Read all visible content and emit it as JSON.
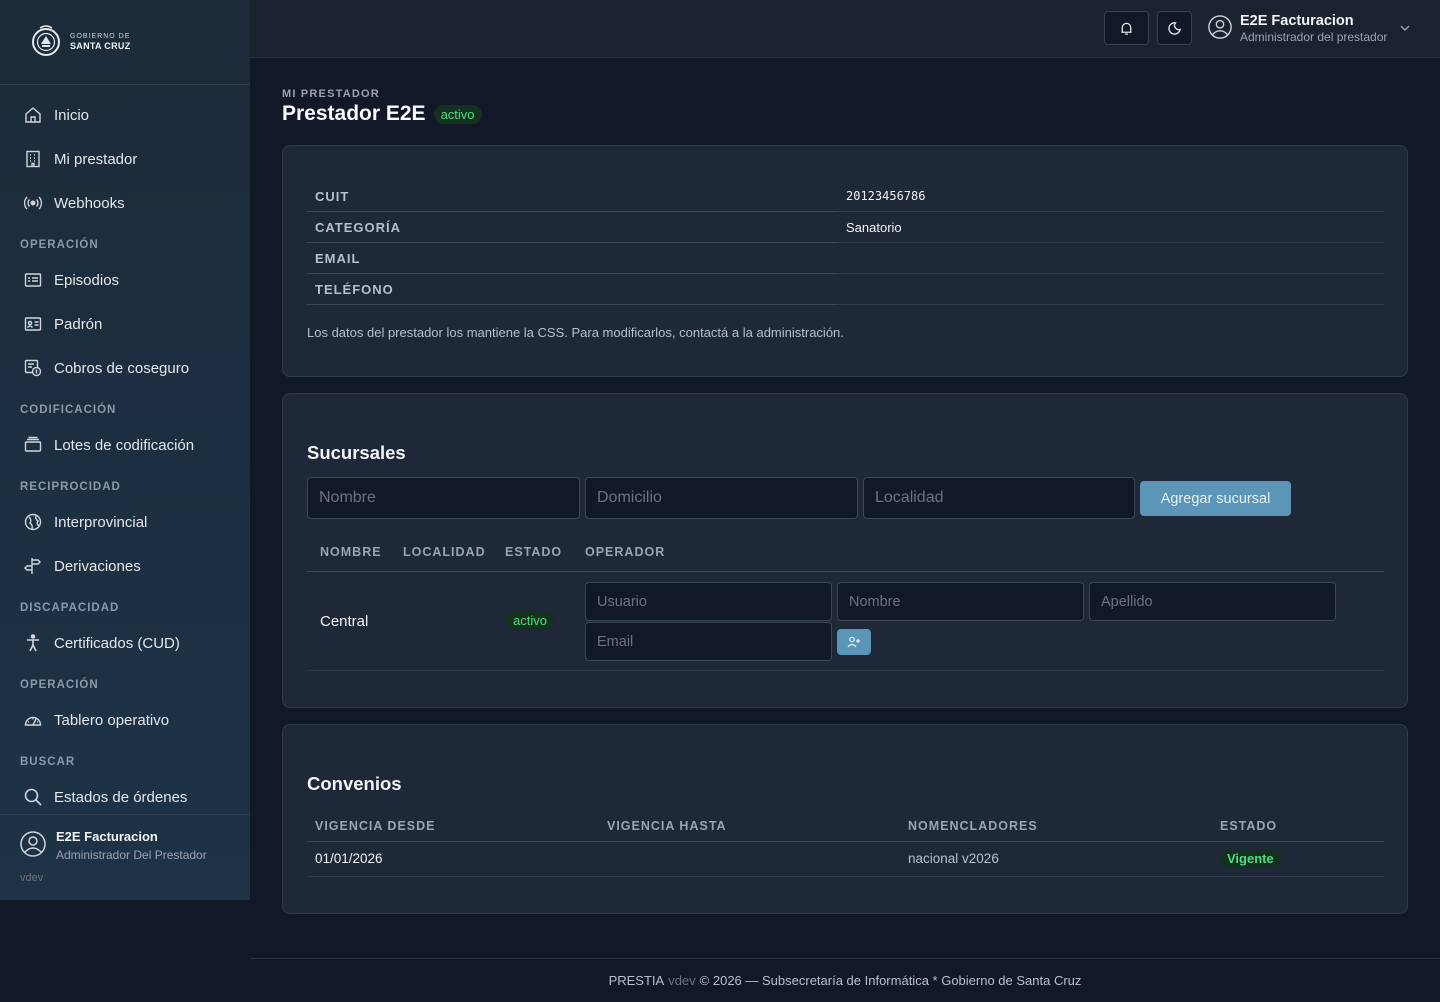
{
  "logo": {
    "line1": "GOBIERNO DE",
    "line2": "SANTA CRUZ"
  },
  "sidebar": {
    "items": [
      {
        "label": "Inicio",
        "icon": "home-icon"
      },
      {
        "label": "Mi prestador",
        "icon": "building-icon"
      },
      {
        "label": "Webhooks",
        "icon": "broadcast-icon"
      },
      {
        "section": "OPERACIÓN"
      },
      {
        "label": "Episodios",
        "icon": "list-card-icon"
      },
      {
        "label": "Padrón",
        "icon": "id-card-icon"
      },
      {
        "label": "Cobros de coseguro",
        "icon": "coin-icon"
      },
      {
        "section": "CODIFICACIÓN"
      },
      {
        "label": "Lotes de codificación",
        "icon": "stack-icon"
      },
      {
        "section": "RECIPROCIDAD"
      },
      {
        "label": "Interprovincial",
        "icon": "globe-icon"
      },
      {
        "label": "Derivaciones",
        "icon": "signpost-icon"
      },
      {
        "section": "DISCAPACIDAD"
      },
      {
        "label": "Certificados (CUD)",
        "icon": "accessibility-icon"
      },
      {
        "section": "OPERACIÓN"
      },
      {
        "label": "Tablero operativo",
        "icon": "gauge-icon"
      },
      {
        "section": "BUSCAR"
      },
      {
        "label": "Estados de órdenes",
        "icon": "search-icon"
      }
    ],
    "user": {
      "name": "E2E Facturacion",
      "role": "Administrador Del Prestador"
    },
    "version": "vdev"
  },
  "topbar": {
    "user": {
      "name": "E2E Facturacion",
      "role": "Administrador del prestador"
    }
  },
  "page": {
    "eyebrow": "MI PRESTADOR",
    "title": "Prestador E2E",
    "status": "activo"
  },
  "info": {
    "rows": [
      {
        "key": "CUIT",
        "value": "20123456786"
      },
      {
        "key": "CATEGORÍA",
        "value": "Sanatorio"
      },
      {
        "key": "EMAIL",
        "value": ""
      },
      {
        "key": "TELÉFONO",
        "value": ""
      }
    ],
    "note": "Los datos del prestador los mantiene la CSS. Para modificarlos, contactá a la administración."
  },
  "sucursales": {
    "title": "Sucursales",
    "form": {
      "nombre": "Nombre",
      "domicilio": "Domicilio",
      "localidad": "Localidad",
      "button": "Agregar sucursal"
    },
    "columns": [
      "NOMBRE",
      "LOCALIDAD",
      "ESTADO",
      "OPERADOR"
    ],
    "rows": [
      {
        "nombre": "Central",
        "localidad": "",
        "estado": "activo",
        "operador": {
          "usuario": "Usuario",
          "nombre": "Nombre",
          "apellido": "Apellido",
          "email": "Email"
        }
      }
    ]
  },
  "convenios": {
    "title": "Convenios",
    "columns": [
      "VIGENCIA DESDE",
      "VIGENCIA HASTA",
      "NOMENCLADORES",
      "ESTADO"
    ],
    "rows": [
      {
        "desde": "01/01/2026",
        "hasta": "",
        "nomencladores": "nacional v2026",
        "estado": "Vigente"
      }
    ]
  },
  "footer": {
    "brand": "PRESTIA",
    "version": "vdev",
    "text": "© 2026 — Subsecretaría de Informática * Gobierno de Santa Cruz"
  },
  "colors": {
    "accent": "#5b95b8",
    "success": "#4ade80",
    "background": "#111827",
    "card": "#1e2838"
  }
}
